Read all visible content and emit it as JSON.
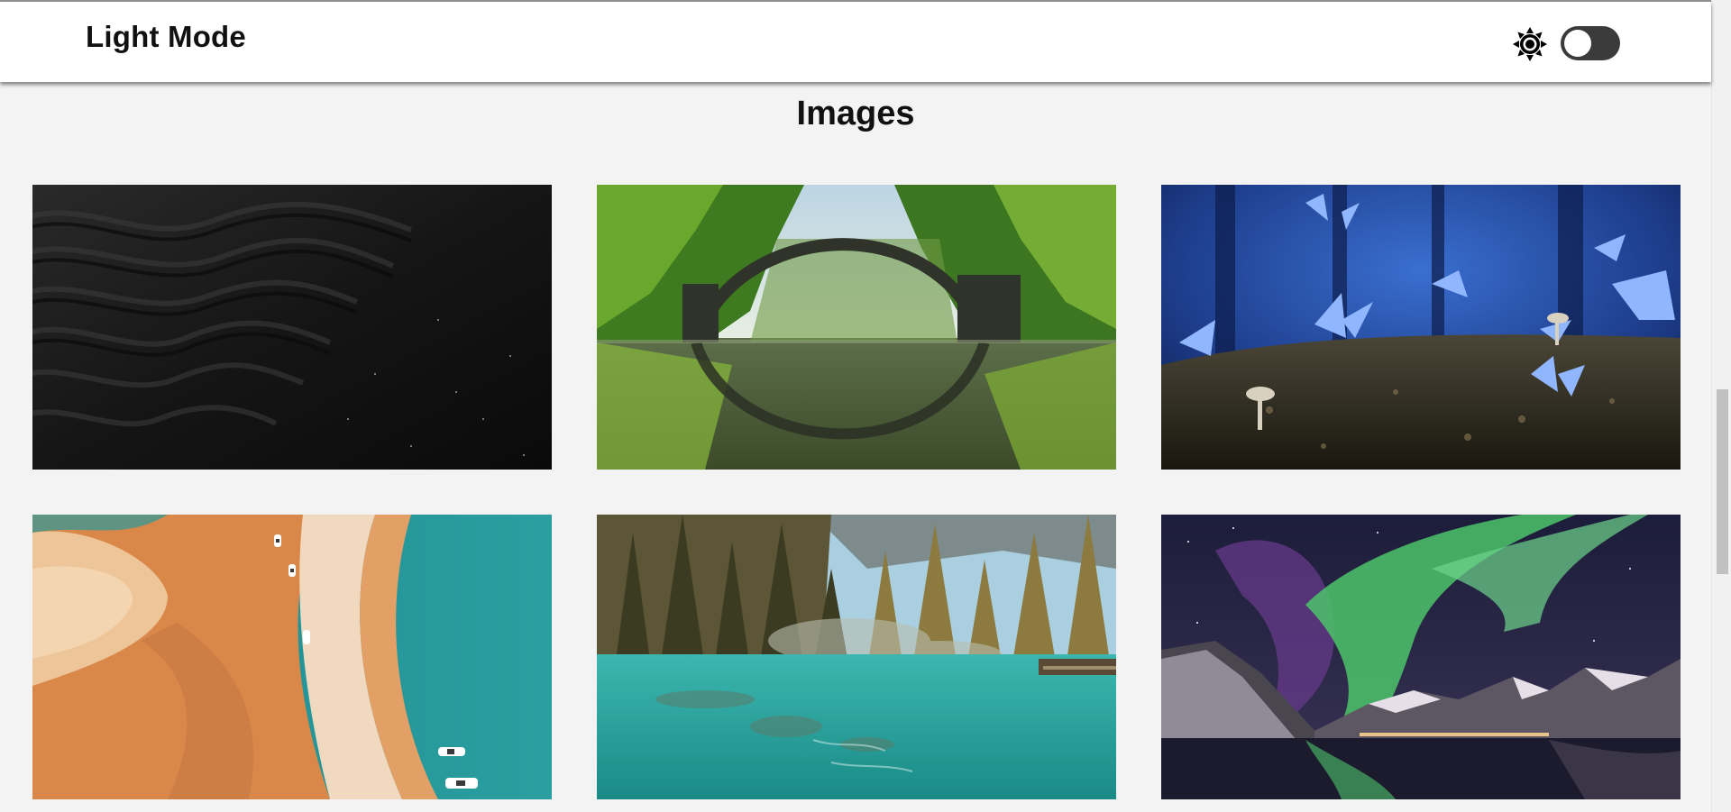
{
  "navbar": {
    "brand": "Light Mode",
    "theme_icon": "sun-icon",
    "toggle_state": "off"
  },
  "main": {
    "title": "Images"
  },
  "gallery": [
    {
      "subject": "black sand dunes"
    },
    {
      "subject": "stone arch bridge reflected in lake"
    },
    {
      "subject": "blue butterflies and mushrooms"
    },
    {
      "subject": "aerial sandbar with boats"
    },
    {
      "subject": "turquoise forest lake"
    },
    {
      "subject": "aurora over fjord mountains"
    }
  ],
  "colors": {
    "page_bg": "#f3f3f3",
    "navbar_bg": "#ffffff",
    "toggle_bg": "#3b3b3b",
    "text": "#111111"
  }
}
